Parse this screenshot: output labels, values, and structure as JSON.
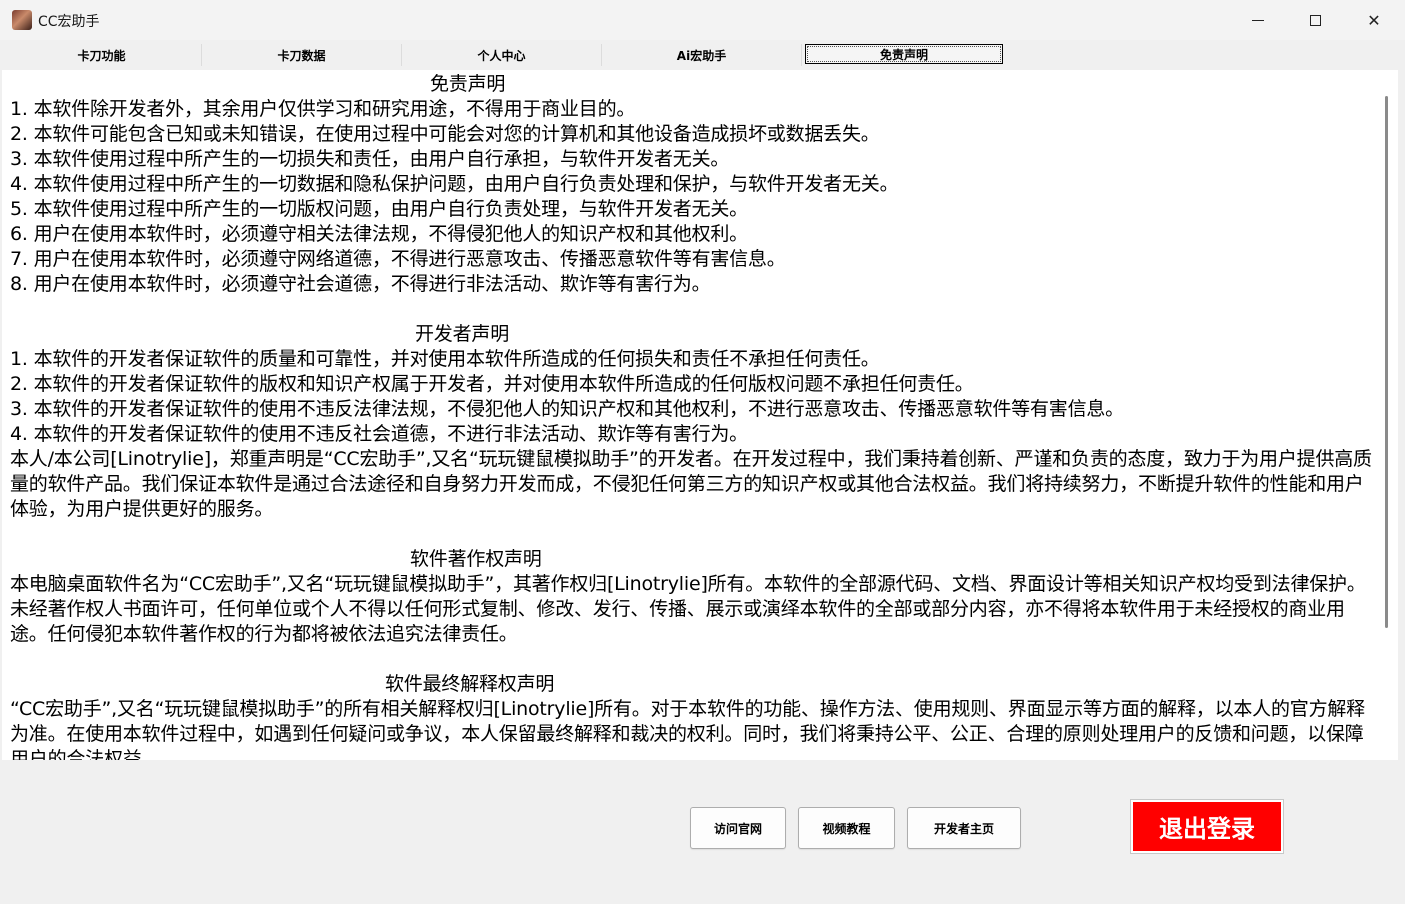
{
  "window": {
    "title": "CC宏助手",
    "minimize_icon": "minimize-icon",
    "maximize_icon": "maximize-icon",
    "close_glyph": "✕"
  },
  "tabs": [
    {
      "label": "卡刀功能"
    },
    {
      "label": "卡刀数据"
    },
    {
      "label": "个人中心"
    },
    {
      "label": "Ai宏助手"
    },
    {
      "label": "免责声明"
    }
  ],
  "active_tab": "免责声明",
  "disclaimer": {
    "heading": "免责声明",
    "items": [
      "1. 本软件除开发者外，其余用户仅供学习和研究用途，不得用于商业目的。",
      "2. 本软件可能包含已知或未知错误，在使用过程中可能会对您的计算机和其他设备造成损坏或数据丢失。",
      "3. 本软件使用过程中所产生的一切损失和责任，由用户自行承担，与软件开发者无关。",
      "4. 本软件使用过程中所产生的一切数据和隐私保护问题，由用户自行负责处理和保护，与软件开发者无关。",
      "5. 本软件使用过程中所产生的一切版权问题，由用户自行负责处理，与软件开发者无关。",
      "6. 用户在使用本软件时，必须遵守相关法律法规，不得侵犯他人的知识产权和其他权利。",
      "7. 用户在使用本软件时，必须遵守网络道德，不得进行恶意攻击、传播恶意软件等有害信息。",
      "8. 用户在使用本软件时，必须遵守社会道德，不得进行非法活动、欺诈等有害行为。"
    ]
  },
  "developer": {
    "heading": "开发者声明",
    "items": [
      "1. 本软件的开发者保证软件的质量和可靠性，并对使用本软件所造成的任何损失和责任不承担任何责任。",
      "2. 本软件的开发者保证软件的版权和知识产权属于开发者，并对使用本软件所造成的任何版权问题不承担任何责任。",
      "3. 本软件的开发者保证软件的使用不违反法律法规，不侵犯他人的知识产权和其他权利，不进行恶意攻击、传播恶意软件等有害信息。",
      "4. 本软件的开发者保证软件的使用不违反社会道德，不进行非法活动、欺诈等有害行为。"
    ],
    "paragraph": "本人/本公司[Linotrylie]，郑重声明是“CC宏助手”,又名“玩玩键鼠模拟助手”的开发者。在开发过程中，我们秉持着创新、严谨和负责的态度，致力于为用户提供高质量的软件产品。我们保证本软件是通过合法途径和自身努力开发而成，不侵犯任何第三方的知识产权或其他合法权益。我们将持续努力，不断提升软件的性能和用户体验，为用户提供更好的服务。"
  },
  "copyright": {
    "heading": "软件著作权声明",
    "paragraph": "本电脑桌面软件名为“CC宏助手”,又名“玩玩键鼠模拟助手”，其著作权归[Linotrylie]所有。本软件的全部源代码、文档、界面设计等相关知识产权均受到法律保护。未经著作权人书面许可，任何单位或个人不得以任何形式复制、修改、发行、传播、展示或演绎本软件的全部或部分内容，亦不得将本软件用于未经授权的商业用途。任何侵犯本软件著作权的行为都将被依法追究法律责任。"
  },
  "interpretation": {
    "heading": "软件最终解释权声明",
    "paragraph": "“CC宏助手”,又名“玩玩键鼠模拟助手”的所有相关解释权归[Linotrylie]所有。对于本软件的功能、操作方法、使用规则、界面显示等方面的解释，以本人的官方解释为准。在使用本软件过程中，如遇到任何疑问或争议，本人保留最终解释和裁决的权利。同时，我们将秉持公平、公正、合理的原则处理用户的反馈和问题，以保障用户的合法权益。"
  },
  "buttons": {
    "official_site": "访问官网",
    "video_tutorial": "视频教程",
    "developer_home": "开发者主页",
    "logout": "退出登录"
  },
  "colors": {
    "logout_bg": "#ff0000",
    "content_bg": "#ffffff",
    "window_bg": "#f0f0f0"
  }
}
